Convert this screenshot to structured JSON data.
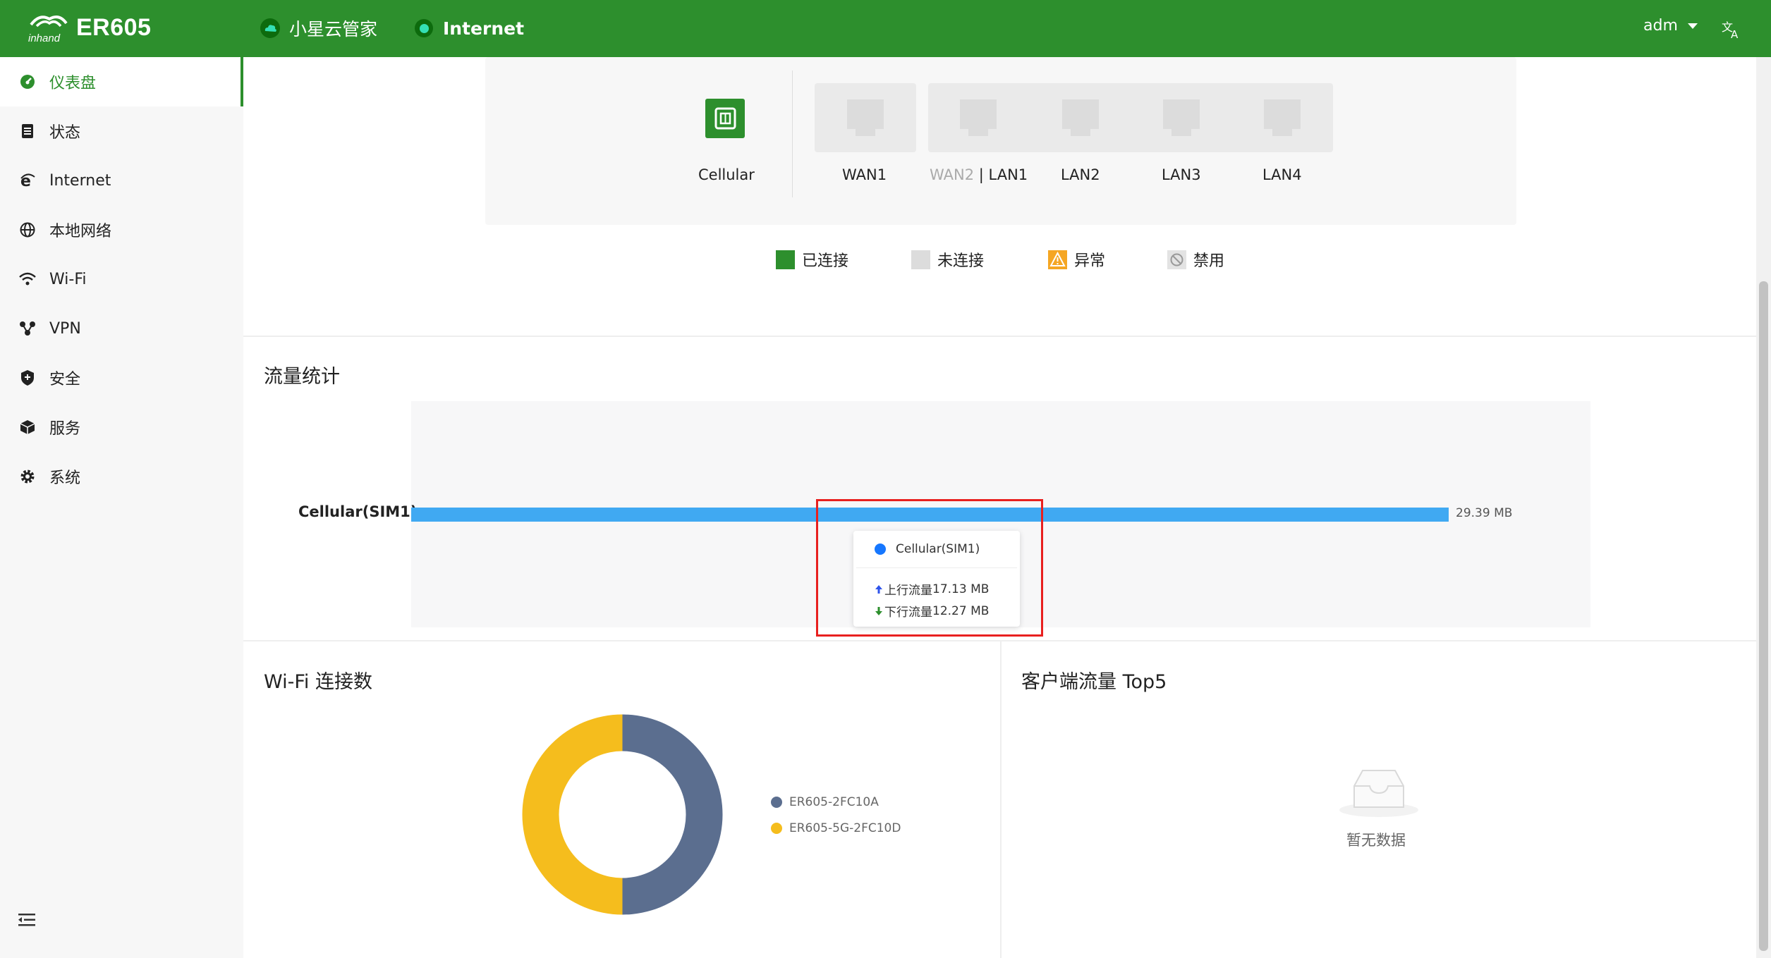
{
  "header": {
    "brand": "ER605",
    "cloud_label": "小星云管家",
    "internet_label": "Internet",
    "user": "adm"
  },
  "sidebar": {
    "items": [
      {
        "label": "仪表盘",
        "icon": "dashboard-icon",
        "active": true
      },
      {
        "label": "状态",
        "icon": "status-icon"
      },
      {
        "label": "Internet",
        "icon": "internet-icon"
      },
      {
        "label": "本地网络",
        "icon": "globe-icon"
      },
      {
        "label": "Wi-Fi",
        "icon": "wifi-icon"
      },
      {
        "label": "VPN",
        "icon": "vpn-icon"
      },
      {
        "label": "安全",
        "icon": "shield-icon"
      },
      {
        "label": "服务",
        "icon": "cube-icon"
      },
      {
        "label": "系统",
        "icon": "gear-icon"
      }
    ]
  },
  "ports": {
    "cellular": "Cellular",
    "wan1": "WAN1",
    "wan2": "WAN2",
    "wan2_sep": "|",
    "lan1": "LAN1",
    "lan2": "LAN2",
    "lan3": "LAN3",
    "lan4": "LAN4"
  },
  "legend": {
    "connected": "已连接",
    "disconnected": "未连接",
    "abnormal": "异常",
    "disabled": "禁用",
    "colors": {
      "connected": "#2d8f2d",
      "disconnected": "#dcdcdc",
      "abnormal": "#f5a623",
      "disabled": "#bfbfbf"
    }
  },
  "traffic": {
    "title": "流量统计",
    "tooltip": {
      "series": "Cellular(SIM1)",
      "up_label": "上行流量",
      "up_value": "17.13 MB",
      "down_label": "下行流量",
      "down_value": "12.27 MB"
    }
  },
  "wifi": {
    "title": "Wi-Fi 连接数"
  },
  "top5": {
    "title": "客户端流量 Top5",
    "empty_text": "暂无数据"
  },
  "chart_data": [
    {
      "type": "bar",
      "orientation": "horizontal",
      "categories": [
        "Cellular(SIM1)"
      ],
      "values": [
        29.39
      ],
      "value_labels": [
        "29.39 MB"
      ],
      "xlim": [
        0,
        33.4
      ],
      "color": "#40a9f2"
    },
    {
      "type": "pie",
      "donut": true,
      "categories": [
        "ER605-2FC10A",
        "ER605-5G-2FC10D"
      ],
      "values": [
        1,
        1
      ],
      "colors": [
        "#5b6e8f",
        "#f5bd1d"
      ],
      "legend": "right"
    }
  ]
}
